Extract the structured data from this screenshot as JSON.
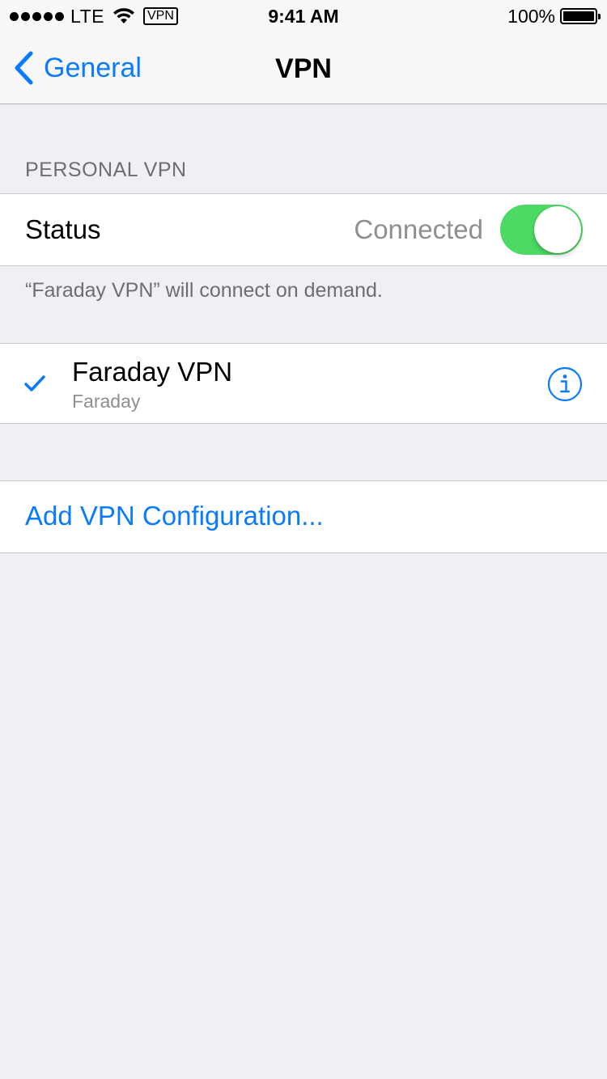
{
  "status_bar": {
    "carrier": "LTE",
    "vpn_badge": "VPN",
    "time": "9:41 AM",
    "battery": "100%",
    "battery_level": 1.0
  },
  "nav": {
    "back_label": "General",
    "title": "VPN"
  },
  "personal_vpn": {
    "header": "PERSONAL VPN",
    "status_label": "Status",
    "status_value": "Connected",
    "toggle_on": true,
    "footer": "“Faraday VPN” will connect on demand."
  },
  "configurations": [
    {
      "name": "Faraday VPN",
      "subtitle": "Faraday",
      "selected": true
    }
  ],
  "add_config_label": "Add VPN Configuration...",
  "colors": {
    "accent": "#0a7aff",
    "toggle_on": "#4cd964",
    "background": "#efeff4",
    "secondary_text": "#8e8e93"
  },
  "icons": [
    "back-chevron-icon",
    "wifi-icon",
    "battery-icon",
    "checkmark-icon",
    "info-icon"
  ]
}
